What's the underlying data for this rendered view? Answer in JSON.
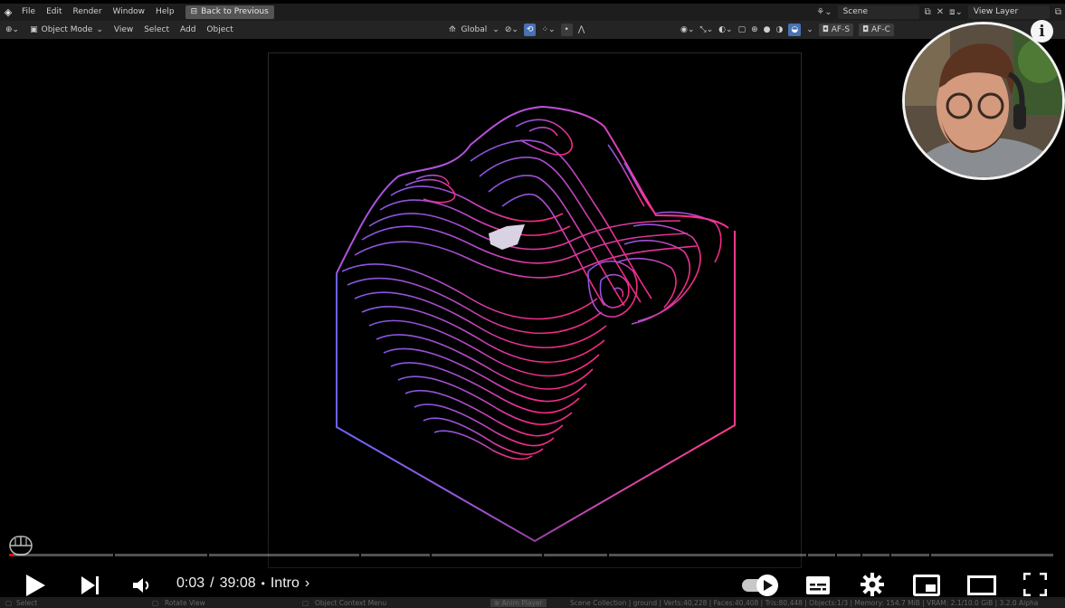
{
  "blender": {
    "menu": [
      "File",
      "Edit",
      "Render",
      "Window",
      "Help"
    ],
    "back_button": "Back to Previous",
    "scene_label": "Scene",
    "view_layer_label": "View Layer",
    "header": {
      "mode": "Object Mode",
      "menus": [
        "View",
        "Select",
        "Add",
        "Object"
      ],
      "orientation": "Global",
      "af_left": "AF-S",
      "af_right": "AF-C"
    },
    "status": {
      "select": "Select",
      "rotate": "Rotate View",
      "context_menu": "Object Context Menu",
      "anim_player": "Anim Player",
      "stats": "Scene Collection | ground | Verts:40,228 | Faces:40,408 | Tris:80,448 | Objects:1/3 | Memory: 154.7 MiB | VRAM: 2.1/10.0 GiB | 3.2.0 Alpha"
    }
  },
  "player": {
    "current_time": "0:03",
    "duration": "39:08",
    "separator": "/",
    "chapter": "Intro",
    "progress": 0.004,
    "colors": {
      "played": "#ff0000",
      "accent_gradient": [
        "#8a5cf0",
        "#ff2f8e"
      ]
    },
    "icons": [
      "play-icon",
      "next-icon",
      "volume-icon",
      "autoplay-toggle",
      "subtitles-icon",
      "settings-icon",
      "miniplayer-icon",
      "theater-icon",
      "fullscreen-icon",
      "info-icon"
    ]
  }
}
